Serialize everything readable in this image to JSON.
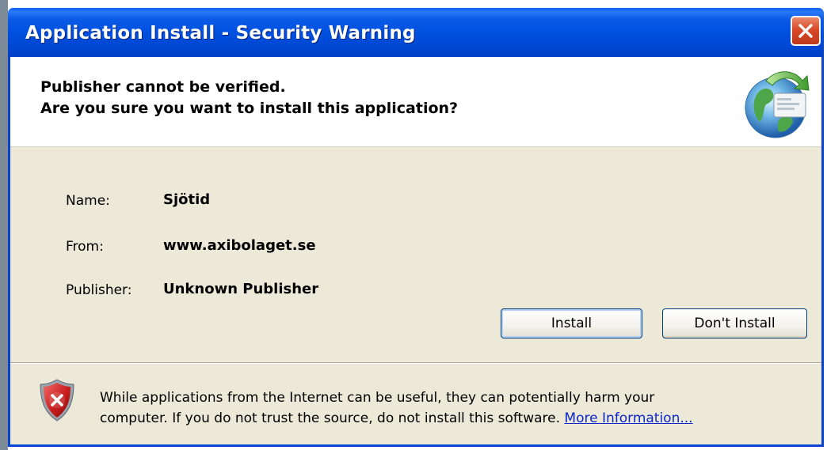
{
  "window": {
    "title": "Application Install - Security Warning",
    "close_icon": "close-x-icon"
  },
  "header": {
    "line1": "Publisher cannot be verified.",
    "line2": "Are you sure you want to install this application?",
    "icon": "globe-install-icon"
  },
  "fields": {
    "name_label": "Name:",
    "name_value": "Sjötid",
    "from_label": "From:",
    "from_value": "www.axibolaget.se",
    "publisher_label": "Publisher:",
    "publisher_value": "Unknown Publisher"
  },
  "buttons": {
    "install": "Install",
    "dont_install": "Don't Install"
  },
  "warning": {
    "line1": "While applications from the Internet can be useful, they can potentially harm your",
    "line2_text": "computer. If you do not trust the source, do not install this software.",
    "more_info": "More Information...",
    "icon": "shield-x-icon"
  },
  "colors": {
    "titlebar": "#0054e3",
    "dialog_bg": "#ece9d8",
    "link": "#0b26c9",
    "close_button": "#d8492a"
  }
}
